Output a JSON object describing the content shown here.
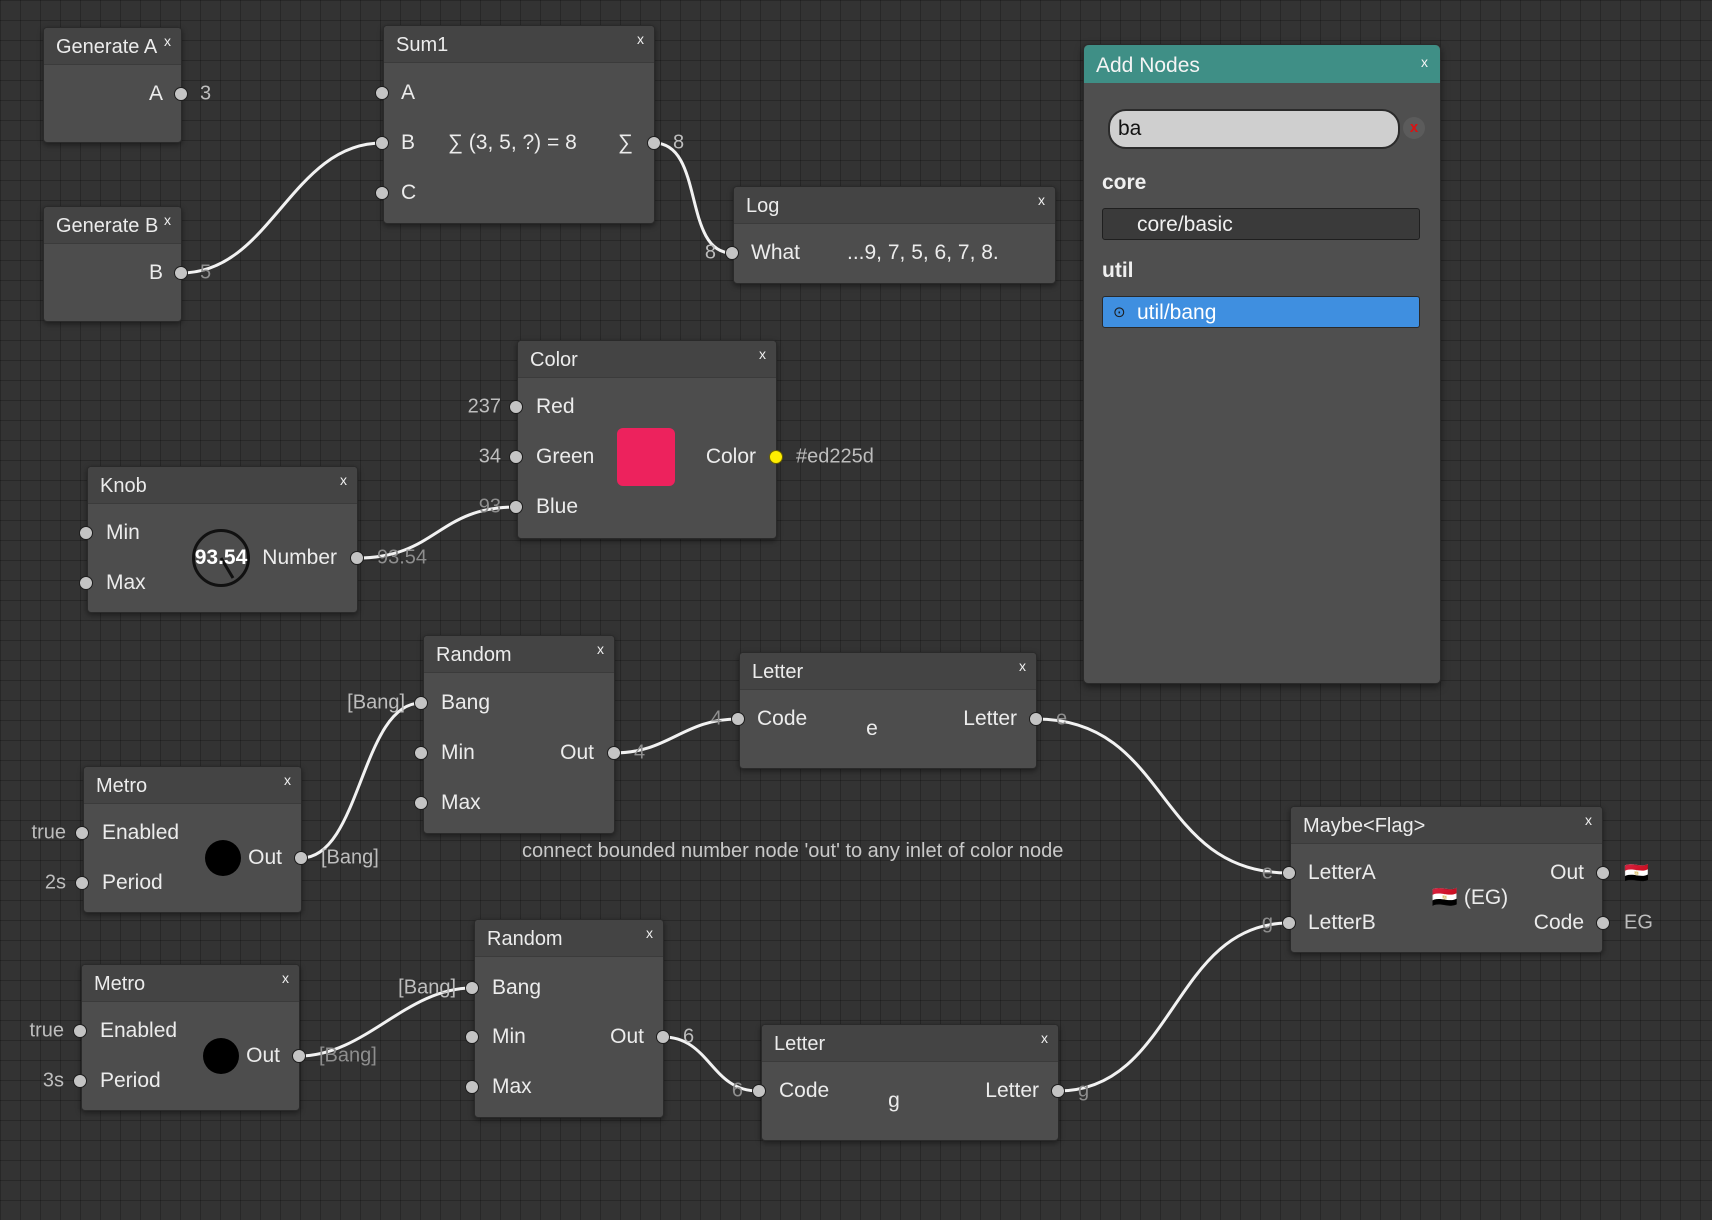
{
  "nodes": {
    "generate_a": {
      "title": "Generate A",
      "out_label": "A",
      "out_value": "3"
    },
    "generate_b": {
      "title": "Generate B",
      "out_label": "B",
      "out_value": "5"
    },
    "sum1": {
      "title": "Sum1",
      "in_a": "A",
      "in_b": "B",
      "in_c": "C",
      "expression": "∑ (3, 5, ?) = 8",
      "out_label": "∑",
      "out_value": "8"
    },
    "log": {
      "title": "Log",
      "in_label": "What",
      "in_value": "8",
      "display": "...9, 7, 5, 6, 7, 8."
    },
    "color": {
      "title": "Color",
      "in_red": "Red",
      "in_green": "Green",
      "in_blue": "Blue",
      "red_value": "237",
      "green_value": "34",
      "blue_value": "93",
      "out_label": "Color",
      "out_value": "#ed225d",
      "swatch_color": "#ed225d"
    },
    "knob": {
      "title": "Knob",
      "in_min": "Min",
      "in_max": "Max",
      "knob_value": "93.54",
      "out_label": "Number",
      "out_value": "93.54"
    },
    "random1": {
      "title": "Random",
      "in_bang": "Bang",
      "in_min": "Min",
      "in_max": "Max",
      "bang_value": "[Bang]",
      "out_label": "Out",
      "out_value": "4"
    },
    "letter1": {
      "title": "Letter",
      "in_label": "Code",
      "in_value": "4",
      "display": "e",
      "out_label": "Letter",
      "out_value": "e"
    },
    "metro1": {
      "title": "Metro",
      "in_enabled": "Enabled",
      "in_period": "Period",
      "enabled_value": "true",
      "period_value": "2s",
      "out_label": "Out",
      "out_value": "[Bang]"
    },
    "metro2": {
      "title": "Metro",
      "in_enabled": "Enabled",
      "in_period": "Period",
      "enabled_value": "true",
      "period_value": "3s",
      "out_label": "Out",
      "out_value": "[Bang]"
    },
    "random2": {
      "title": "Random",
      "in_bang": "Bang",
      "in_min": "Min",
      "in_max": "Max",
      "bang_value": "[Bang]",
      "out_label": "Out",
      "out_value": "6"
    },
    "letter2": {
      "title": "Letter",
      "in_label": "Code",
      "in_value": "6",
      "display": "g",
      "out_label": "Letter",
      "out_value": "g"
    },
    "maybe_flag": {
      "title": "Maybe<Flag>",
      "in_a": "LetterA",
      "in_b": "LetterB",
      "in_a_value": "e",
      "in_b_value": "g",
      "display": "🇪🇬 (EG)",
      "out_label": "Out",
      "out_value": "🇪🇬",
      "code_label": "Code",
      "code_value": "EG"
    }
  },
  "close_glyph": "x",
  "comment": "connect bounded number node 'out' to any inlet of color node",
  "add_nodes": {
    "title": "Add Nodes",
    "search_value": "ba",
    "clear_label": "x",
    "categories": [
      {
        "name": "core",
        "items": [
          {
            "label": "core/basic"
          }
        ]
      },
      {
        "name": "util",
        "items": [
          {
            "label": "util/bang",
            "bullet": "⊙"
          }
        ]
      }
    ]
  },
  "colors": {
    "panel_header": "#3f8f86",
    "selected_item": "#3f8fe0",
    "port_active": "#ffee00"
  }
}
